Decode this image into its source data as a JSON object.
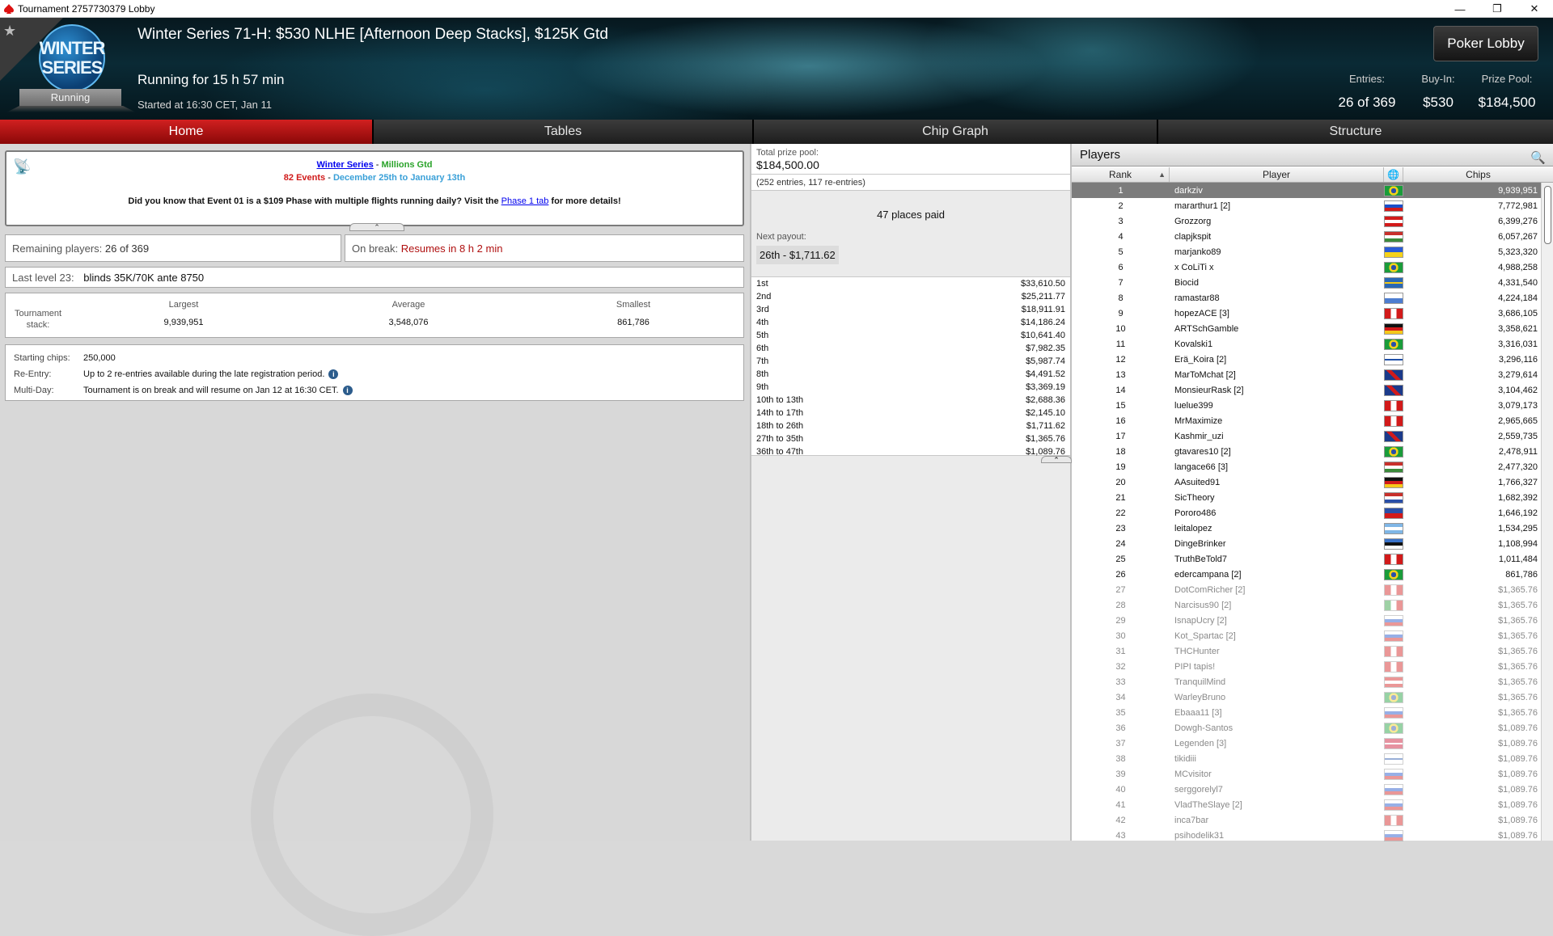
{
  "window": {
    "title": "Tournament 2757730379 Lobby"
  },
  "banner": {
    "logo_line1": "WINTER",
    "logo_line2": "SERIES",
    "status": "Running",
    "name": "Winter Series 71-H: $530 NLHE [Afternoon Deep Stacks], $125K Gtd",
    "running_for": "Running for 15 h 57 min",
    "started": "Started at 16:30 CET, Jan 11",
    "lobby_button": "Poker Lobby",
    "entries_label": "Entries:",
    "entries_value": "26 of 369",
    "buyin_label": "Buy-In:",
    "buyin_value": "$530",
    "prizepool_label": "Prize Pool:",
    "prizepool_value": "$184,500"
  },
  "tabs": [
    "Home",
    "Tables",
    "Chip Graph",
    "Structure"
  ],
  "news": {
    "link1": "Winter Series",
    "sep1": " - ",
    "green1": "Millions Gtd",
    "red2": "82 Events",
    "sep2": " - ",
    "blue2": "December 25th to January 13th",
    "line3_a": "Did you know that Event 01 is a $109 Phase with multiple flights running daily? Visit the ",
    "line3_link": "Phase 1 tab",
    "line3_b": " for more details!"
  },
  "remaining": {
    "label": "Remaining players:",
    "value": "26 of 369"
  },
  "break": {
    "label": "On break:",
    "value": "Resumes in 8 h 2 min"
  },
  "level": {
    "label": "Last level 23:",
    "value": "blinds 35K/70K ante 8750"
  },
  "stack": {
    "row_label": "Tournament stack:",
    "largest_label": "Largest",
    "largest": "9,939,951",
    "average_label": "Average",
    "average": "3,548,076",
    "smallest_label": "Smallest",
    "smallest": "861,786"
  },
  "details": {
    "starting_label": "Starting chips:",
    "starting": "250,000",
    "reentry_label": "Re-Entry:",
    "reentry": "Up to 2 re-entries available during the late registration period.",
    "multiday_label": "Multi-Day:",
    "multiday": "Tournament is on break and will resume on Jan 12 at 16:30 CET."
  },
  "prize": {
    "total_label": "Total prize pool:",
    "total": "$184,500.00",
    "entries_note": "(252 entries, 117 re-entries)",
    "places_paid": "47 places paid",
    "next_label": "Next payout:",
    "next": "26th - $1,711.62",
    "payouts": [
      [
        "1st",
        "$33,610.50"
      ],
      [
        "2nd",
        "$25,211.77"
      ],
      [
        "3rd",
        "$18,911.91"
      ],
      [
        "4th",
        "$14,186.24"
      ],
      [
        "5th",
        "$10,641.40"
      ],
      [
        "6th",
        "$7,982.35"
      ],
      [
        "7th",
        "$5,987.74"
      ],
      [
        "8th",
        "$4,491.52"
      ],
      [
        "9th",
        "$3,369.19"
      ],
      [
        "10th to 13th",
        "$2,688.36"
      ],
      [
        "14th to 17th",
        "$2,145.10"
      ],
      [
        "18th to 26th",
        "$1,711.62"
      ],
      [
        "27th to 35th",
        "$1,365.76"
      ],
      [
        "36th to 47th",
        "$1,089.76"
      ]
    ]
  },
  "players": {
    "title": "Players",
    "cols": {
      "rank": "Rank",
      "player": "Player",
      "chips": "Chips"
    },
    "rows": [
      [
        "1",
        "darkziv",
        "9,939,951",
        "br"
      ],
      [
        "2",
        "mararthur1 [2]",
        "7,772,981",
        "ru"
      ],
      [
        "3",
        "Grozzorg",
        "6,399,276",
        "at"
      ],
      [
        "4",
        "clapjkspit",
        "6,057,267",
        "hu"
      ],
      [
        "5",
        "marjanko89",
        "5,323,320",
        "ua"
      ],
      [
        "6",
        "x CoLiTi x",
        "4,988,258",
        "br"
      ],
      [
        "7",
        "Biocid",
        "4,331,540",
        "se"
      ],
      [
        "8",
        "ramastar88",
        "4,224,184",
        "uy"
      ],
      [
        "9",
        "hopezACE [3]",
        "3,686,105",
        "ca"
      ],
      [
        "10",
        "ARTSchGamble",
        "3,358,621",
        "de"
      ],
      [
        "11",
        "Kovalski1",
        "3,316,031",
        "br"
      ],
      [
        "12",
        "Erä_Koira [2]",
        "3,296,116",
        "fi"
      ],
      [
        "13",
        "MarToMchat [2]",
        "3,279,614",
        "gb"
      ],
      [
        "14",
        "MonsieurRask [2]",
        "3,104,462",
        "gb"
      ],
      [
        "15",
        "luelue399",
        "3,079,173",
        "ca"
      ],
      [
        "16",
        "MrMaximize",
        "2,965,665",
        "ca"
      ],
      [
        "17",
        "Kashmir_uzi",
        "2,559,735",
        "gb"
      ],
      [
        "18",
        "gtavares10 [2]",
        "2,478,911",
        "br"
      ],
      [
        "19",
        "langace66 [3]",
        "2,477,320",
        "hu"
      ],
      [
        "20",
        "AAsuited91",
        "1,766,327",
        "de"
      ],
      [
        "21",
        "SicTheory",
        "1,682,392",
        "nl"
      ],
      [
        "22",
        "Pororo486",
        "1,646,192",
        "ph"
      ],
      [
        "23",
        "leitalopez",
        "1,534,295",
        "ar"
      ],
      [
        "24",
        "DingeBrinker",
        "1,108,994",
        "ee"
      ],
      [
        "25",
        "TruthBeTold7",
        "1,011,484",
        "ca"
      ],
      [
        "26",
        "edercampana [2]",
        "861,786",
        "br"
      ],
      [
        "27",
        "DotComRicher [2]",
        "$1,365.76",
        "ca"
      ],
      [
        "28",
        "Narcisus90 [2]",
        "$1,365.76",
        "it"
      ],
      [
        "29",
        "IsnapUcry [2]",
        "$1,365.76",
        "ru"
      ],
      [
        "30",
        "Kot_Spartac [2]",
        "$1,365.76",
        "ru"
      ],
      [
        "31",
        "THCHunter",
        "$1,365.76",
        "ca"
      ],
      [
        "32",
        "PIPI tapis!",
        "$1,365.76",
        "pe"
      ],
      [
        "33",
        "TranquilMind",
        "$1,365.76",
        "at"
      ],
      [
        "34",
        "WarleyBruno",
        "$1,365.76",
        "br"
      ],
      [
        "35",
        "Ebaaa11 [3]",
        "$1,365.76",
        "ru"
      ],
      [
        "36",
        "Dowgh-Santos",
        "$1,089.76",
        "br"
      ],
      [
        "37",
        "Legenden [3]",
        "$1,089.76",
        "dk"
      ],
      [
        "38",
        "tikidiii",
        "$1,089.76",
        "fi"
      ],
      [
        "39",
        "MCvisitor",
        "$1,089.76",
        "ru"
      ],
      [
        "40",
        "serggorelyl7",
        "$1,089.76",
        "ru"
      ],
      [
        "41",
        "VladTheSlaye [2]",
        "$1,089.76",
        "ru"
      ],
      [
        "42",
        "inca7bar",
        "$1,089.76",
        "pe"
      ],
      [
        "43",
        "psihodelik31",
        "$1,089.76",
        "ru"
      ]
    ]
  }
}
